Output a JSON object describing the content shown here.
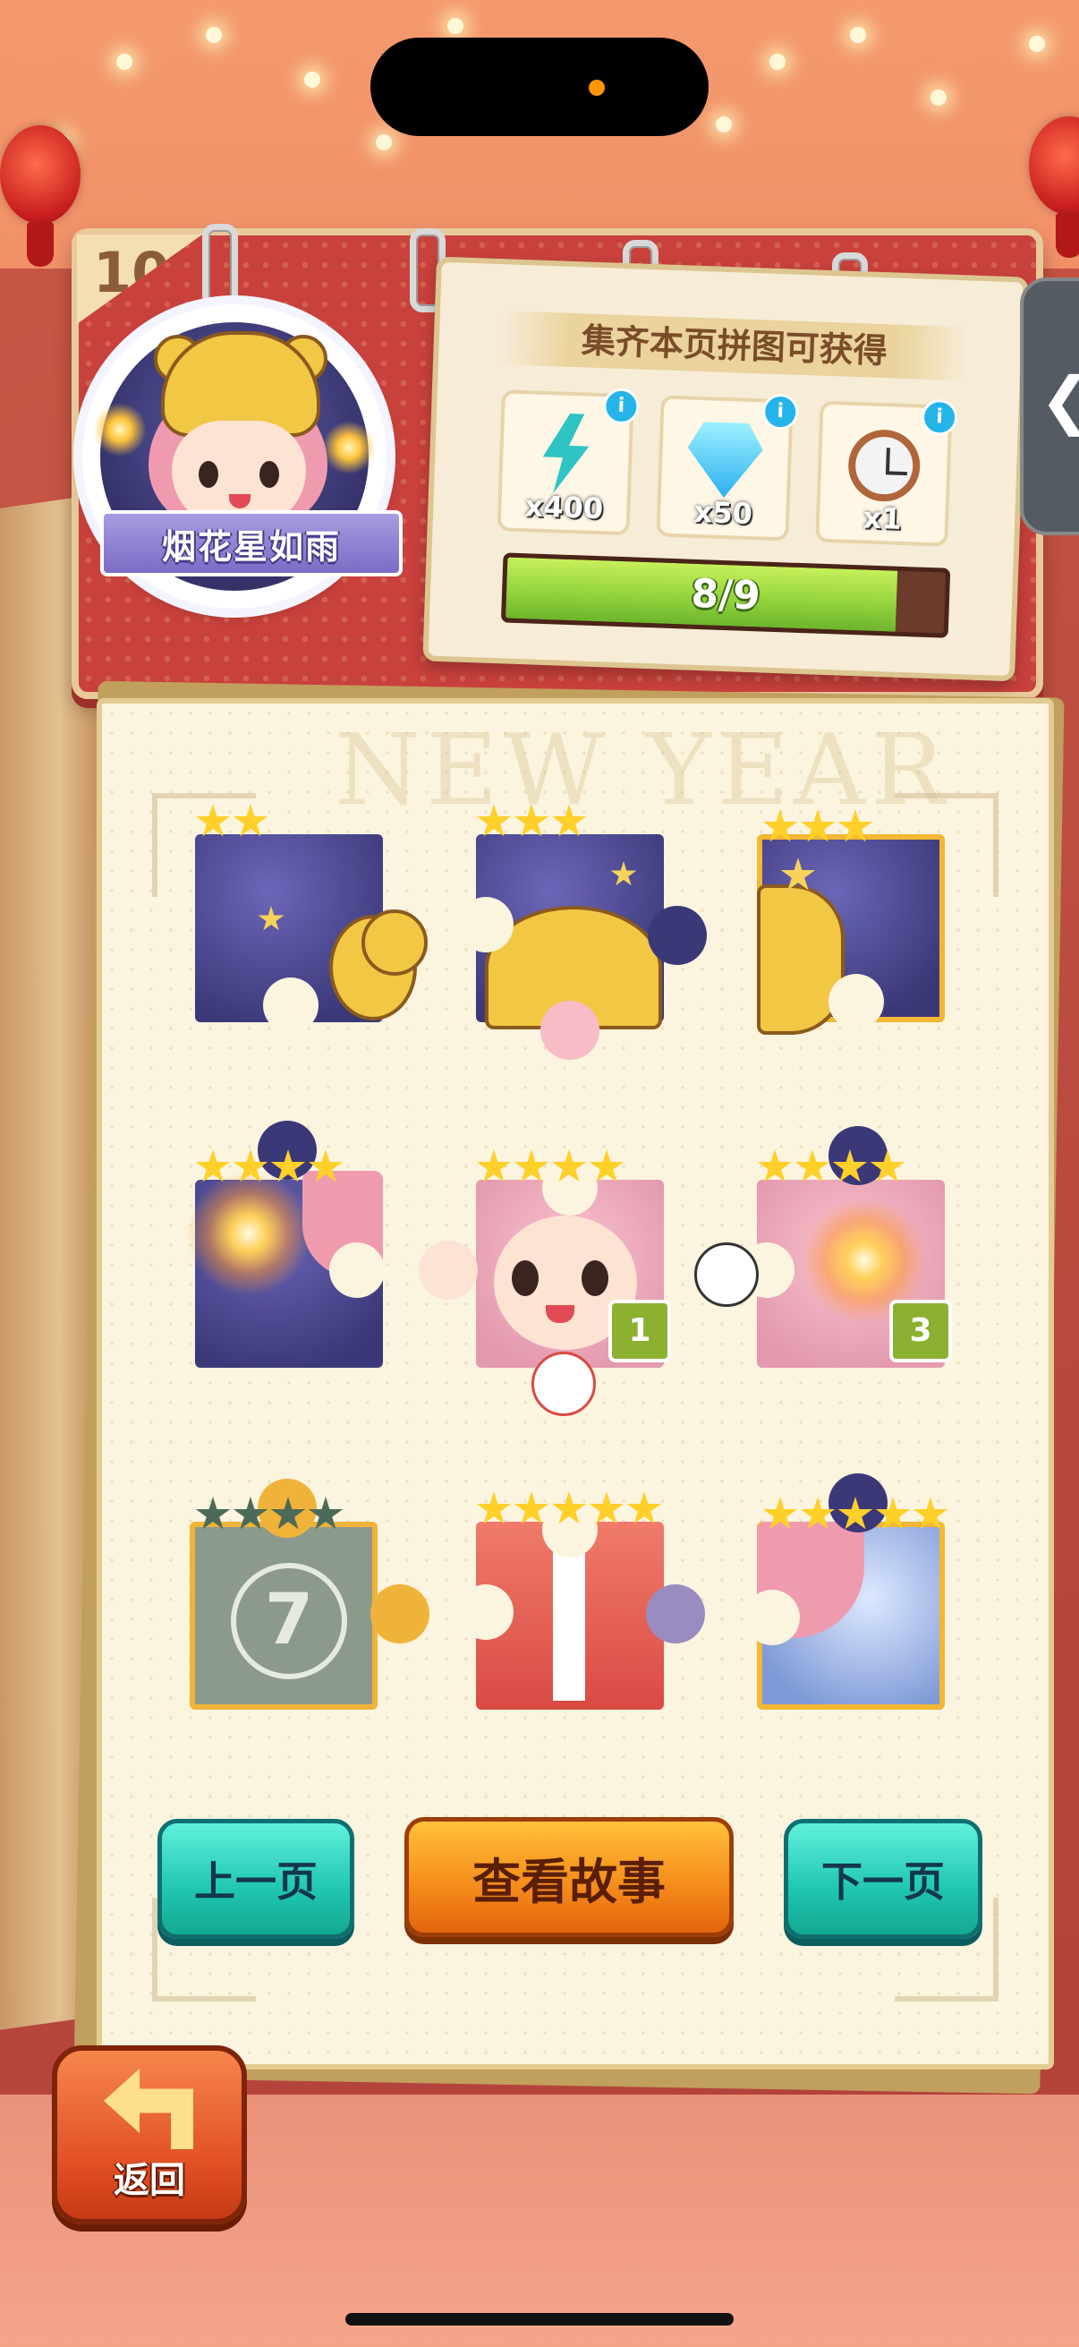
{
  "page": {
    "number": "10"
  },
  "character": {
    "name": "烟花星如雨"
  },
  "rewards": {
    "title": "集齐本页拼图可获得",
    "items": [
      {
        "icon": "lightning-icon",
        "qty": "x400",
        "info": "i"
      },
      {
        "icon": "diamond-icon",
        "qty": "x50",
        "info": "i"
      },
      {
        "icon": "clock-icon",
        "qty": "x1",
        "info": "i"
      }
    ],
    "progress": {
      "text": "8/9",
      "current": 8,
      "total": 9
    }
  },
  "board": {
    "watermark": "NEW YEAR"
  },
  "puzzles": [
    {
      "stars": 2,
      "unlocked": true
    },
    {
      "stars": 3,
      "unlocked": true
    },
    {
      "stars": 3,
      "unlocked": true
    },
    {
      "stars": 4,
      "unlocked": true
    },
    {
      "stars": 4,
      "unlocked": true,
      "count": "1"
    },
    {
      "stars": 4,
      "unlocked": true,
      "count": "3"
    },
    {
      "stars": 4,
      "unlocked": false,
      "lock_number": "7"
    },
    {
      "stars": 5,
      "unlocked": true
    },
    {
      "stars": 5,
      "unlocked": true
    }
  ],
  "buttons": {
    "prev": "上一页",
    "story": "查看故事",
    "next": "下一页",
    "back": "返回"
  },
  "side_tab": {
    "label": "❮"
  },
  "colors": {
    "accent_teal": "#20c6b0",
    "accent_orange": "#f48a1a",
    "progress_green": "#8fd13a",
    "panel_red": "#c9413c"
  }
}
